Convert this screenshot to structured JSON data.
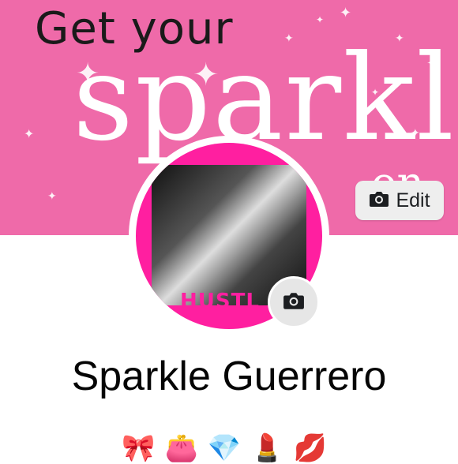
{
  "cover": {
    "line1": "Get your",
    "line2": "sparkle",
    "line3": "on",
    "bg_color": "#ef6aa9"
  },
  "edit_button": {
    "icon": "camera-icon",
    "label": "Edit"
  },
  "profile": {
    "avatar_text": "HUSTL",
    "camera_badge_icon": "camera-icon",
    "name": "Sparkle Guerrero",
    "bio_emojis": "🎀👛💎💄💋"
  }
}
